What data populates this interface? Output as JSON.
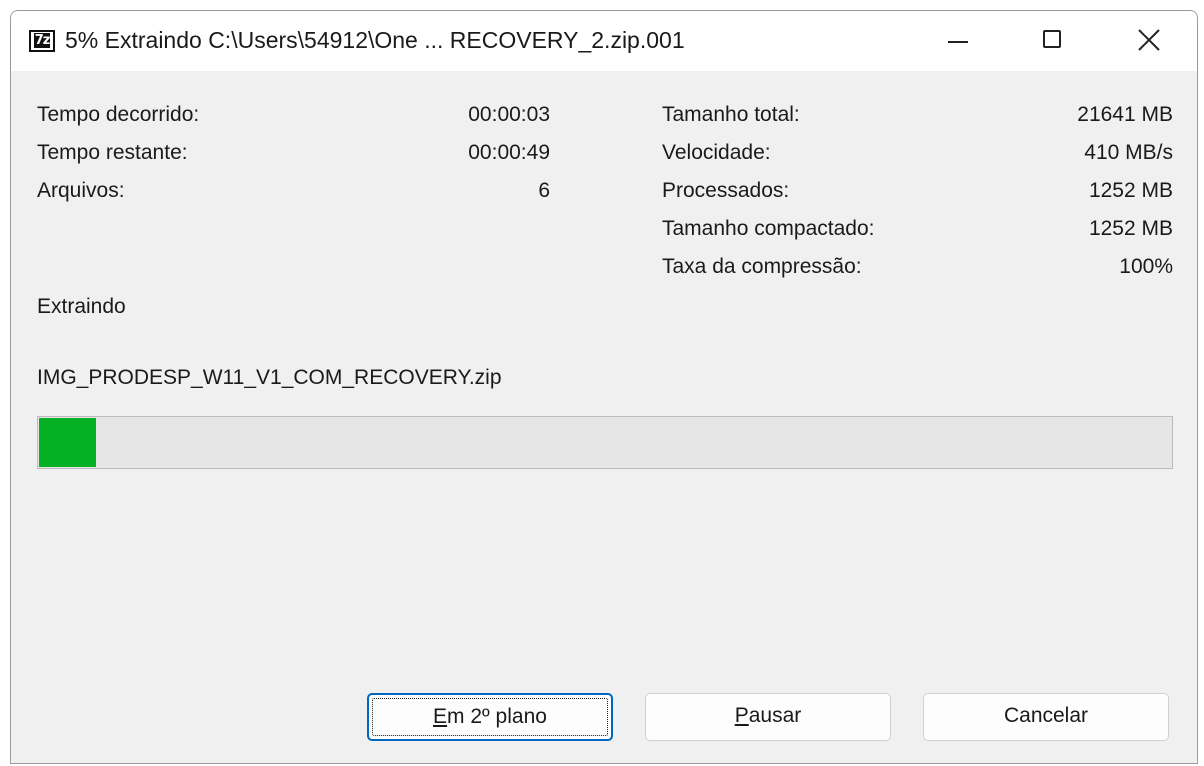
{
  "window": {
    "title": "5% Extraindo C:\\Users\\54912\\One ... RECOVERY_2.zip.001",
    "app_icon_text": "7z",
    "controls": [
      "minimize",
      "maximize",
      "close"
    ]
  },
  "stats_left": [
    {
      "label": "Tempo decorrido:",
      "value": "00:00:03"
    },
    {
      "label": "Tempo restante:",
      "value": "00:00:49"
    },
    {
      "label": "Arquivos:",
      "value": "6"
    }
  ],
  "stats_right": [
    {
      "label": "Tamanho total:",
      "value": "21641 MB"
    },
    {
      "label": "Velocidade:",
      "value": "410 MB/s"
    },
    {
      "label": "Processados:",
      "value": "1252 MB"
    },
    {
      "label": "Tamanho compactado:",
      "value": "1252 MB"
    },
    {
      "label": "Taxa da compressão:",
      "value": "100%"
    }
  ],
  "status": {
    "operation": "Extraindo",
    "current_file": "IMG_PRODESP_W11_V1_COM_RECOVERY.zip"
  },
  "progress": {
    "percent": 5,
    "fill_color": "#06b025"
  },
  "buttons": {
    "background": {
      "accel": "E",
      "rest": "m 2º plano"
    },
    "pause": {
      "accel": "P",
      "rest": "ausar"
    },
    "cancel": {
      "label": "Cancelar"
    }
  },
  "icons": {
    "minimize": "minimize-icon",
    "maximize": "maximize-icon",
    "close": "close-icon"
  }
}
